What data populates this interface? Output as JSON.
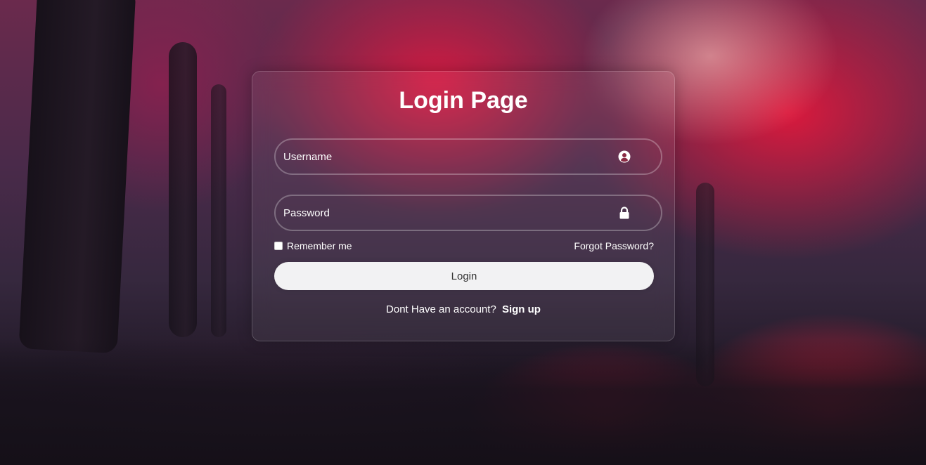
{
  "login": {
    "title": "Login Page",
    "username_placeholder": "Username",
    "password_placeholder": "Password",
    "remember_label": "Remember me",
    "forgot_label": "Forgot Password?",
    "submit_label": "Login",
    "no_account_text": "Dont Have an account?",
    "signup_label": "Sign up"
  },
  "icons": {
    "username": "user-circle-icon",
    "password": "lock-icon"
  },
  "colors": {
    "text": "#ffffff",
    "button_bg": "#f2f2f3",
    "button_text": "#333333",
    "accent_red": "#e2183c"
  }
}
